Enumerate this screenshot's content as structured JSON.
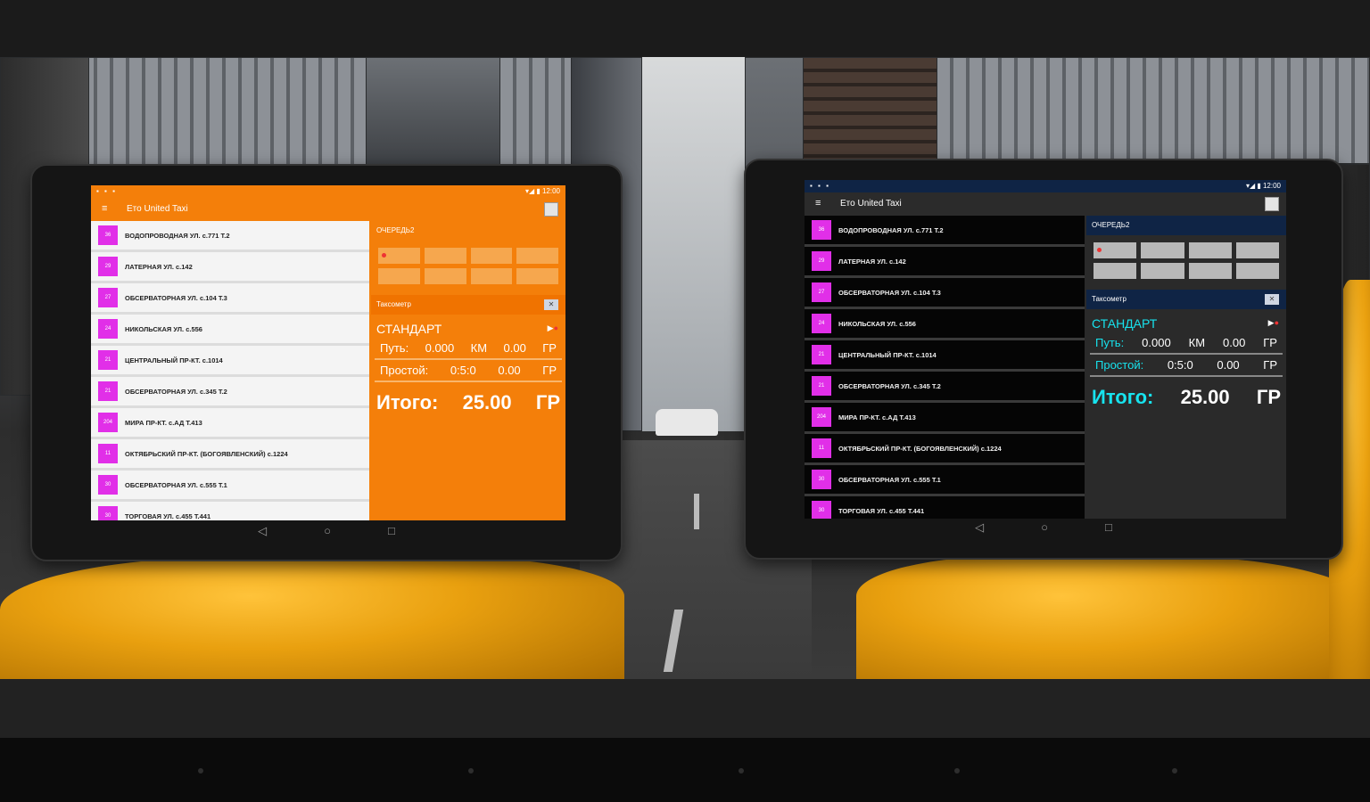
{
  "tablets": [
    {
      "theme": "orange",
      "accent": "#f47f0a",
      "status_right": "▾◢ ▮ 12:00",
      "app_title": "Ето United Taxi",
      "orders": [
        {
          "badge": "36",
          "address": "ВОДОПРОВОДНАЯ УЛ. с.771 Т.2"
        },
        {
          "badge": "29",
          "address": "ЛАТЕРНАЯ УЛ. с.142"
        },
        {
          "badge": "27",
          "address": "ОБСЕРВАТОРНАЯ УЛ. с.104 Т.3"
        },
        {
          "badge": "24",
          "address": "НИКОЛЬСКАЯ УЛ. с.556"
        },
        {
          "badge": "21",
          "address": "ЦЕНТРАЛЬНЫЙ ПР-КТ. с.1014"
        },
        {
          "badge": "21",
          "address": "ОБСЕРВАТОРНАЯ УЛ. с.345 Т.2"
        },
        {
          "badge": "204",
          "address": "МИРА ПР-КТ. с.АД Т.413"
        },
        {
          "badge": "11",
          "address": "ОКТЯБРЬСКИЙ ПР-КТ. (БОГОЯВЛЕНСКИЙ) с.1224"
        },
        {
          "badge": "30",
          "address": "ОБСЕРВАТОРНАЯ УЛ. с.555 Т.1"
        },
        {
          "badge": "30",
          "address": "ТОРГОВАЯ УЛ. с.455 Т.441"
        }
      ],
      "queues_label": "ОЧЕРЕДЬ2",
      "taximeter_label": "Таксометр",
      "tariff": "СТАНДАРТ",
      "path_label": "Путь:",
      "path_km": "0.000",
      "km_unit": "КМ",
      "path_cost": "0.00",
      "currency": "ГР",
      "idle_label": "Простой:",
      "idle_time": "0:5:0",
      "idle_cost": "0.00",
      "total_label": "Итого:",
      "total_value": "25.00"
    },
    {
      "theme": "dark",
      "accent": "#17e3ee",
      "status_right": "▾◢ ▮ 12:00",
      "app_title": "Ето United Taxi",
      "orders": [
        {
          "badge": "36",
          "address": "ВОДОПРОВОДНАЯ УЛ. с.771 Т.2"
        },
        {
          "badge": "29",
          "address": "ЛАТЕРНАЯ УЛ. с.142"
        },
        {
          "badge": "27",
          "address": "ОБСЕРВАТОРНАЯ УЛ. с.104 Т.3"
        },
        {
          "badge": "24",
          "address": "НИКОЛЬСКАЯ УЛ. с.556"
        },
        {
          "badge": "21",
          "address": "ЦЕНТРАЛЬНЫЙ ПР-КТ. с.1014"
        },
        {
          "badge": "21",
          "address": "ОБСЕРВАТОРНАЯ УЛ. с.345 Т.2"
        },
        {
          "badge": "204",
          "address": "МИРА ПР-КТ. с.АД Т.413"
        },
        {
          "badge": "11",
          "address": "ОКТЯБРЬСКИЙ ПР-КТ. (БОГОЯВЛЕНСКИЙ) с.1224"
        },
        {
          "badge": "30",
          "address": "ОБСЕРВАТОРНАЯ УЛ. с.555 Т.1"
        },
        {
          "badge": "30",
          "address": "ТОРГОВАЯ УЛ. с.455 Т.441"
        }
      ],
      "queues_label": "ОЧЕРЕДЬ2",
      "taximeter_label": "Таксометр",
      "tariff": "СТАНДАРТ",
      "path_label": "Путь:",
      "path_km": "0.000",
      "km_unit": "КМ",
      "path_cost": "0.00",
      "currency": "ГР",
      "idle_label": "Простой:",
      "idle_time": "0:5:0",
      "idle_cost": "0.00",
      "total_label": "Итого:",
      "total_value": "25.00"
    }
  ],
  "nav_icons": [
    "back-icon",
    "home-icon",
    "recents-icon"
  ]
}
